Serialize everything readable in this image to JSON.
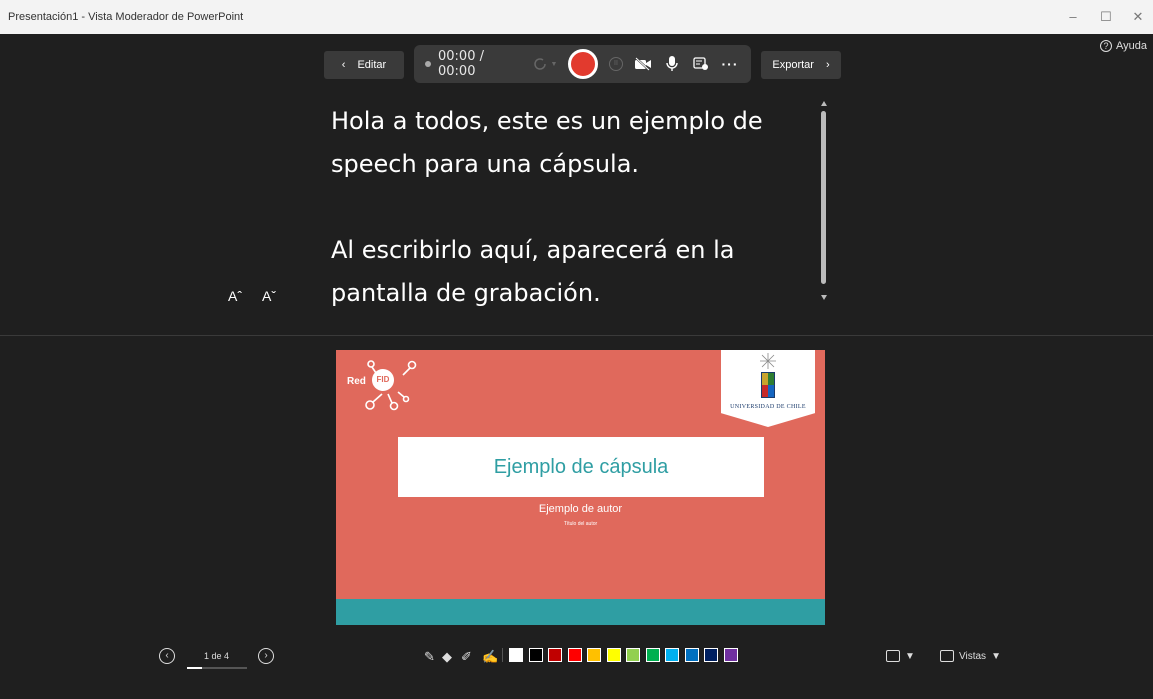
{
  "window": {
    "title": "Presentación1 - Vista Moderador de PowerPoint",
    "minimize": "–",
    "maximize": "☐",
    "close": "✕"
  },
  "help": {
    "label": "Ayuda"
  },
  "nav": {
    "edit_label": "Editar",
    "export_label": "Exportar"
  },
  "recorder": {
    "timer": "00:00 / 00:00"
  },
  "notes": {
    "text": "Hola a todos, este es un ejemplo de speech para una cápsula.\n\nAl escribirlo aquí, aparecerá en la pantalla de grabación."
  },
  "font_controls": {
    "increase": "Aˆ",
    "decrease": "Aˇ"
  },
  "slide": {
    "logo_text_red": "Red",
    "logo_text_fid": "FID",
    "university": "UNIVERSIDAD DE CHILE",
    "title": "Ejemplo de cápsula",
    "author": "Ejemplo de autor",
    "author_title": "Título del autor",
    "colors": {
      "background": "#e0695c",
      "band": "#2f9ea3",
      "title": "#2f9ea3"
    }
  },
  "pager": {
    "label": "1 de 4",
    "progress": 0.25
  },
  "swatches": [
    "#ffffff",
    "#000000",
    "#c00000",
    "#ff0000",
    "#ffc000",
    "#ffff00",
    "#92d050",
    "#00b050",
    "#00b0f0",
    "#0070c0",
    "#002060",
    "#7030a0"
  ],
  "bottom_right": {
    "views_label": "Vistas"
  }
}
